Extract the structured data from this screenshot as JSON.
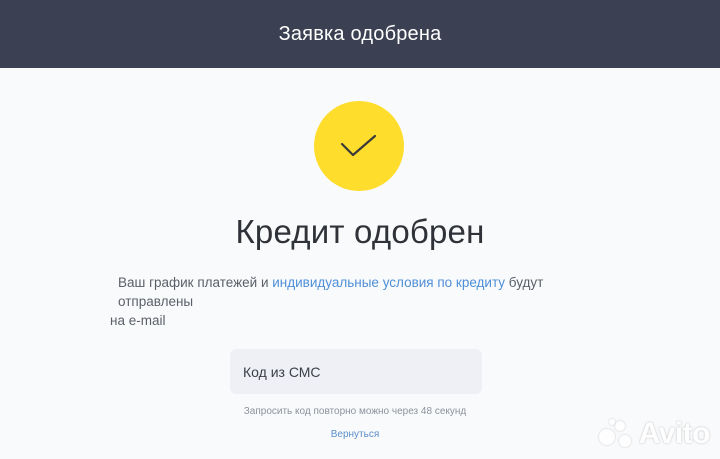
{
  "header": {
    "title": "Заявка одобрена"
  },
  "status": {
    "icon": "checkmark-icon",
    "circle_color": "#ffdd2d",
    "title": "Кредит одобрен"
  },
  "info": {
    "text_before": "Ваш график платежей и ",
    "link_text": "индивидуальные условия по кредиту",
    "text_after": " будут отправлены",
    "text_second_line": "на e-mail"
  },
  "sms": {
    "placeholder": "Код из СМС",
    "value": ""
  },
  "resend": {
    "text": "Запросить код повторно можно через 48 секунд"
  },
  "back": {
    "label": "Вернуться"
  },
  "watermark": {
    "text": "Avito"
  },
  "colors": {
    "header_bg": "#3b4152",
    "page_bg": "#f9fafb",
    "accent_yellow": "#ffdd2d",
    "link_blue": "#4f8fd8"
  }
}
